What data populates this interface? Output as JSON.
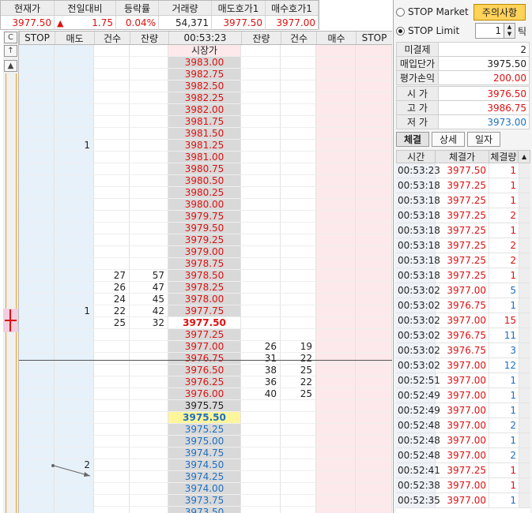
{
  "quote": {
    "headers": [
      "현재가",
      "전일대비",
      "등락률",
      "거래량",
      "매도호가1",
      "매수호가1"
    ],
    "current_price": "3977.50",
    "change_arrow": "▲",
    "change": "1.75",
    "change_rate": "0.04%",
    "volume": "54,371",
    "ask1": "3977.50",
    "bid1": "3977.00"
  },
  "left_buttons": [
    "C",
    "↑",
    "▲"
  ],
  "grid_headers": [
    "STOP",
    "매도",
    "건수",
    "잔량",
    "00:53:23",
    "잔량",
    "건수",
    "매수",
    "STOP"
  ],
  "open_label": "시장가",
  "ladder": [
    {
      "price": "3983.00",
      "color": "up"
    },
    {
      "price": "3982.75",
      "color": "up"
    },
    {
      "price": "3982.50",
      "color": "up"
    },
    {
      "price": "3982.25",
      "color": "up"
    },
    {
      "price": "3982.00",
      "color": "up"
    },
    {
      "price": "3981.75",
      "color": "up"
    },
    {
      "price": "3981.50",
      "color": "up"
    },
    {
      "price": "3981.25",
      "color": "up",
      "sell": "1"
    },
    {
      "price": "3981.00",
      "color": "up"
    },
    {
      "price": "3980.75",
      "color": "up"
    },
    {
      "price": "3980.50",
      "color": "up"
    },
    {
      "price": "3980.25",
      "color": "up"
    },
    {
      "price": "3980.00",
      "color": "up"
    },
    {
      "price": "3979.75",
      "color": "up"
    },
    {
      "price": "3979.50",
      "color": "up"
    },
    {
      "price": "3979.25",
      "color": "up"
    },
    {
      "price": "3979.00",
      "color": "up"
    },
    {
      "price": "3978.75",
      "color": "up"
    },
    {
      "price": "3978.50",
      "color": "up",
      "cnt1": "27",
      "rem1": "57"
    },
    {
      "price": "3978.25",
      "color": "up",
      "cnt1": "26",
      "rem1": "47"
    },
    {
      "price": "3978.00",
      "color": "up",
      "cnt1": "24",
      "rem1": "45"
    },
    {
      "price": "3977.75",
      "color": "up",
      "sell": "1",
      "cnt1": "22",
      "rem1": "42"
    },
    {
      "price": "3977.50",
      "color": "cur",
      "cnt1": "25",
      "rem1": "32"
    },
    {
      "price": "3977.25",
      "color": "up"
    },
    {
      "price": "3977.00",
      "color": "up",
      "rem2": "26",
      "cnt2": "19"
    },
    {
      "price": "3976.75",
      "color": "up",
      "rem2": "31",
      "cnt2": "22"
    },
    {
      "price": "3976.50",
      "color": "up",
      "rem2": "38",
      "cnt2": "25"
    },
    {
      "price": "3976.25",
      "color": "up",
      "rem2": "36",
      "cnt2": "22"
    },
    {
      "price": "3976.00",
      "color": "up",
      "rem2": "40",
      "cnt2": "25"
    },
    {
      "price": "3975.75",
      "color": "blk"
    },
    {
      "price": "3975.50",
      "color": "hl"
    },
    {
      "price": "3975.25",
      "color": "dn"
    },
    {
      "price": "3975.00",
      "color": "dn"
    },
    {
      "price": "3974.75",
      "color": "dn"
    },
    {
      "price": "3974.50",
      "color": "dn",
      "sell": "2"
    },
    {
      "price": "3974.25",
      "color": "dn"
    },
    {
      "price": "3974.00",
      "color": "dn"
    },
    {
      "price": "3973.75",
      "color": "dn"
    },
    {
      "price": "3973.50",
      "color": "dn"
    }
  ],
  "right": {
    "stop_market": "STOP Market",
    "stop_limit": "STOP Limit",
    "warning": "주의사항",
    "tick_value": "1",
    "tick_label": "틱",
    "info1": [
      {
        "k": "미결제",
        "v": "2",
        "c": "#222"
      },
      {
        "k": "매입단가",
        "v": "3975.50",
        "c": "#222"
      },
      {
        "k": "평가손익",
        "v": "200.00",
        "c": "#d11"
      }
    ],
    "info2": [
      {
        "k": "시 가",
        "v": "3976.50",
        "c": "#d11"
      },
      {
        "k": "고 가",
        "v": "3986.75",
        "c": "#d11"
      },
      {
        "k": "저 가",
        "v": "3973.00",
        "c": "#1e6fc2"
      }
    ],
    "tabs": [
      "체결",
      "상세",
      "일자"
    ],
    "trade_headers": [
      "시간",
      "체결가",
      "체결량"
    ],
    "trades": [
      {
        "t": "00:53:23",
        "p": "3977.50",
        "q": "1",
        "pc": "#d11",
        "qc": "#d11"
      },
      {
        "t": "00:53:18",
        "p": "3977.25",
        "q": "1",
        "pc": "#d11",
        "qc": "#d11"
      },
      {
        "t": "00:53:18",
        "p": "3977.25",
        "q": "1",
        "pc": "#d11",
        "qc": "#d11"
      },
      {
        "t": "00:53:18",
        "p": "3977.25",
        "q": "2",
        "pc": "#d11",
        "qc": "#d11"
      },
      {
        "t": "00:53:18",
        "p": "3977.25",
        "q": "1",
        "pc": "#d11",
        "qc": "#d11"
      },
      {
        "t": "00:53:18",
        "p": "3977.25",
        "q": "2",
        "pc": "#d11",
        "qc": "#d11"
      },
      {
        "t": "00:53:18",
        "p": "3977.25",
        "q": "2",
        "pc": "#d11",
        "qc": "#d11"
      },
      {
        "t": "00:53:18",
        "p": "3977.25",
        "q": "1",
        "pc": "#d11",
        "qc": "#d11"
      },
      {
        "t": "00:53:02",
        "p": "3977.00",
        "q": "5",
        "pc": "#d11",
        "qc": "#1e6fc2"
      },
      {
        "t": "00:53:02",
        "p": "3976.75",
        "q": "1",
        "pc": "#d11",
        "qc": "#1e6fc2"
      },
      {
        "t": "00:53:02",
        "p": "3977.00",
        "q": "15",
        "pc": "#d11",
        "qc": "#d11"
      },
      {
        "t": "00:53:02",
        "p": "3976.75",
        "q": "11",
        "pc": "#d11",
        "qc": "#1e6fc2"
      },
      {
        "t": "00:53:02",
        "p": "3976.75",
        "q": "3",
        "pc": "#d11",
        "qc": "#1e6fc2"
      },
      {
        "t": "00:53:02",
        "p": "3977.00",
        "q": "12",
        "pc": "#d11",
        "qc": "#1e6fc2"
      },
      {
        "t": "00:52:51",
        "p": "3977.00",
        "q": "1",
        "pc": "#d11",
        "qc": "#1e6fc2"
      },
      {
        "t": "00:52:49",
        "p": "3977.00",
        "q": "1",
        "pc": "#d11",
        "qc": "#1e6fc2"
      },
      {
        "t": "00:52:49",
        "p": "3977.00",
        "q": "1",
        "pc": "#d11",
        "qc": "#1e6fc2"
      },
      {
        "t": "00:52:48",
        "p": "3977.00",
        "q": "2",
        "pc": "#d11",
        "qc": "#1e6fc2"
      },
      {
        "t": "00:52:48",
        "p": "3977.00",
        "q": "1",
        "pc": "#d11",
        "qc": "#1e6fc2"
      },
      {
        "t": "00:52:48",
        "p": "3977.00",
        "q": "2",
        "pc": "#d11",
        "qc": "#1e6fc2"
      },
      {
        "t": "00:52:41",
        "p": "3977.25",
        "q": "1",
        "pc": "#d11",
        "qc": "#d11"
      },
      {
        "t": "00:52:38",
        "p": "3977.00",
        "q": "1",
        "pc": "#d11",
        "qc": "#d11"
      },
      {
        "t": "00:52:35",
        "p": "3977.00",
        "q": "1",
        "pc": "#d11",
        "qc": "#1e6fc2"
      }
    ]
  }
}
